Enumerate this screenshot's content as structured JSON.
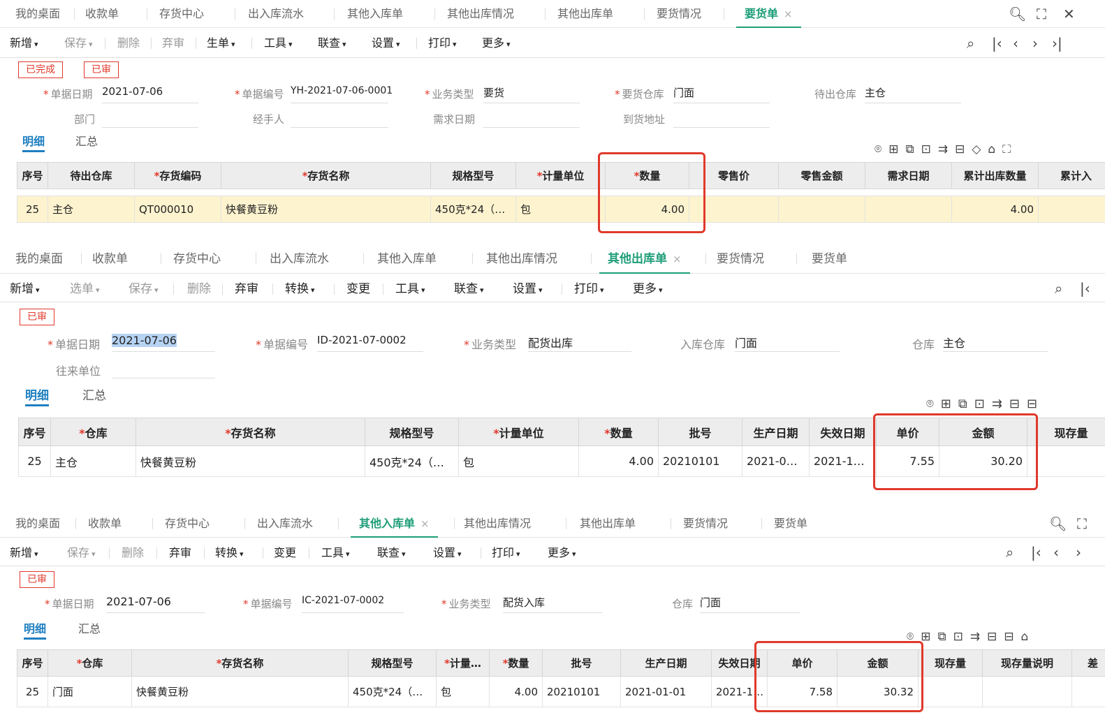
{
  "panel1": {
    "tabs": [
      "我的桌面",
      "收款单",
      "存货中心",
      "出入库流水",
      "其他入库单",
      "其他出库情况",
      "其他出库单",
      "要货情况",
      "要货单"
    ],
    "tab_close": "×",
    "toolbar": [
      "新增",
      "保存",
      "删除",
      "弃审",
      "生单",
      "工具",
      "联查",
      "设置",
      "打印",
      "更多"
    ],
    "badges": [
      "已完成",
      "已审"
    ],
    "fields": {
      "date_label": "单据日期",
      "date": "2021-07-06",
      "no_label": "单据编号",
      "no": "YH-2021-07-06-0001",
      "biz_label": "业务类型",
      "biz": "要货",
      "wh_label": "要货仓库",
      "wh": "门面",
      "out_wh_label": "待出仓库",
      "out_wh": "主仓",
      "dept_label": "部门",
      "handler_label": "经手人",
      "need_date_label": "需求日期",
      "addr_label": "到货地址"
    },
    "subtabs": [
      "明细",
      "汇总"
    ],
    "columns": [
      "序号",
      "待出仓库",
      "存货编码",
      "存货名称",
      "规格型号",
      "计量单位",
      "数量",
      "零售价",
      "零售金额",
      "需求日期",
      "累计出库数量",
      "累计入"
    ],
    "row": {
      "seq": "25",
      "wh": "主仓",
      "code": "QT000010",
      "name": "快餐黄豆粉",
      "spec": "450克*24（…",
      "unit": "包",
      "qty": "4.00",
      "out_qty": "4.00"
    }
  },
  "panel2": {
    "tabs": [
      "我的桌面",
      "收款单",
      "存货中心",
      "出入库流水",
      "其他入库单",
      "其他出库情况",
      "其他出库单",
      "要货情况",
      "要货单"
    ],
    "tab_close": "×",
    "toolbar": [
      "新增",
      "选单",
      "保存",
      "删除",
      "弃审",
      "转换",
      "变更",
      "工具",
      "联查",
      "设置",
      "打印",
      "更多"
    ],
    "badges": [
      "已审"
    ],
    "fields": {
      "date_label": "单据日期",
      "date": "2021-07-06",
      "no_label": "单据编号",
      "no": "ID-2021-07-0002",
      "biz_label": "业务类型",
      "biz": "配货出库",
      "in_wh_label": "入库仓库",
      "in_wh": "门面",
      "wh_label": "仓库",
      "wh": "主仓",
      "partner_label": "往来单位"
    },
    "subtabs": [
      "明细",
      "汇总"
    ],
    "columns": [
      "序号",
      "仓库",
      "存货名称",
      "规格型号",
      "计量单位",
      "数量",
      "批号",
      "生产日期",
      "失效日期",
      "单价",
      "金额",
      "现存量"
    ],
    "row": {
      "seq": "25",
      "wh": "主仓",
      "name": "快餐黄豆粉",
      "spec": "450克*24（…",
      "unit": "包",
      "qty": "4.00",
      "batch": "20210101",
      "prod": "2021-0…",
      "exp": "2021-1…",
      "price": "7.55",
      "amount": "30.20"
    }
  },
  "panel3": {
    "tabs": [
      "我的桌面",
      "收款单",
      "存货中心",
      "出入库流水",
      "其他入库单",
      "其他出库情况",
      "其他出库单",
      "要货情况",
      "要货单"
    ],
    "tab_close": "×",
    "toolbar": [
      "新增",
      "保存",
      "删除",
      "弃审",
      "转换",
      "变更",
      "工具",
      "联查",
      "设置",
      "打印",
      "更多"
    ],
    "badges": [
      "已审"
    ],
    "fields": {
      "date_label": "单据日期",
      "date": "2021-07-06",
      "no_label": "单据编号",
      "no": "IC-2021-07-0002",
      "biz_label": "业务类型",
      "biz": "配货入库",
      "wh_label": "仓库",
      "wh": "门面"
    },
    "subtabs": [
      "明细",
      "汇总"
    ],
    "columns": [
      "序号",
      "仓库",
      "存货名称",
      "规格型号",
      "计量…",
      "数量",
      "批号",
      "生产日期",
      "失效日期",
      "单价",
      "金额",
      "现存量",
      "现存量说明",
      "差"
    ],
    "row": {
      "seq": "25",
      "wh": "门面",
      "name": "快餐黄豆粉",
      "spec": "450克*24（…",
      "unit": "包",
      "qty": "4.00",
      "batch": "20210101",
      "prod": "2021-01-01",
      "exp": "2021-1…",
      "price": "7.58",
      "amount": "30.32"
    }
  },
  "colors": {
    "accent": "#1e9e78",
    "highlight_border": "#e0392b",
    "subtab_blue": "#1e7fc0",
    "row_yellow": "#fdf3cf"
  }
}
